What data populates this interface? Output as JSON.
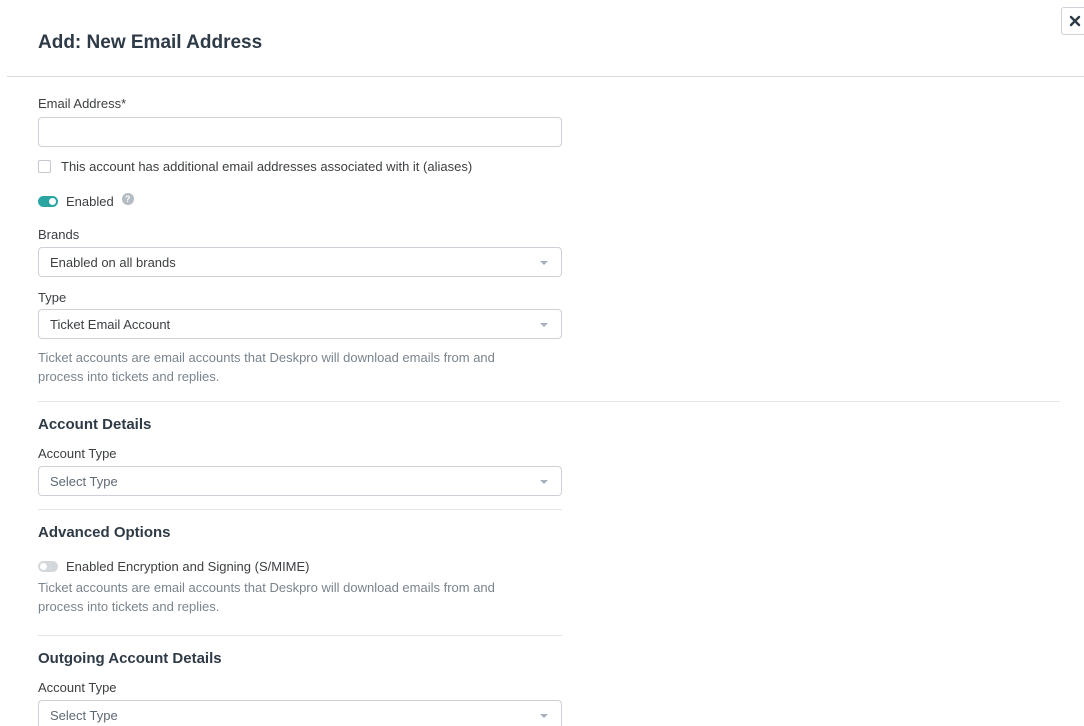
{
  "dialog": {
    "title": "Add: New Email Address",
    "close_label": "✕"
  },
  "email_field": {
    "label": "Email Address*",
    "value": "",
    "placeholder": ""
  },
  "aliases_checkbox": {
    "label": "This account has additional email addresses associated with it (aliases)",
    "checked": false
  },
  "enabled_toggle": {
    "label": "Enabled",
    "on": true,
    "help_icon": "?"
  },
  "brands": {
    "label": "Brands",
    "value": "Enabled on all brands"
  },
  "type": {
    "label": "Type",
    "value": "Ticket Email Account",
    "help": "Ticket accounts are email accounts that Deskpro will download emails from and process into tickets and replies."
  },
  "account_details": {
    "heading": "Account Details",
    "account_type_label": "Account Type",
    "account_type_value": "Select Type"
  },
  "advanced_options": {
    "heading": "Advanced Options",
    "smime_label": "Enabled Encryption and Signing (S/MIME)",
    "smime_on": false,
    "help": "Ticket accounts are email accounts that Deskpro will download emails from and process into tickets and replies."
  },
  "outgoing_account_details": {
    "heading": "Outgoing Account Details",
    "account_type_label": "Account Type",
    "account_type_value": "Select Type"
  },
  "colors": {
    "accent_toggle": "#2aa5a2",
    "heading": "#2e3a46",
    "help_text": "#7a848d"
  }
}
